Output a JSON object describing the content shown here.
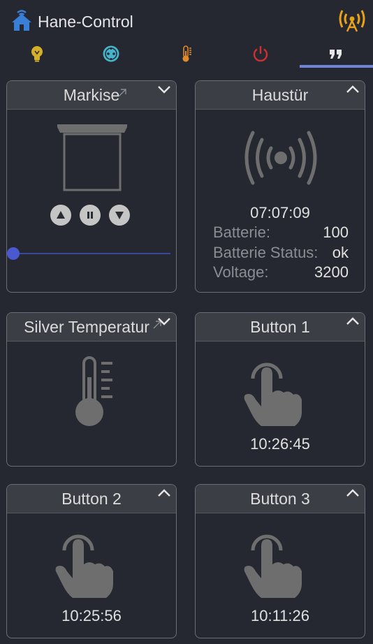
{
  "app": {
    "title": "Hane-Control"
  },
  "colors": {
    "background": "#252830",
    "card_header": "#3b3e45",
    "accent": "#6f84d8",
    "slider": "#4a59d0",
    "home_icon": "#3a7fd6",
    "signal_icon": "#e8a21a"
  },
  "tabs": [
    {
      "icon": "lightbulb-icon",
      "color": "#d4b02a"
    },
    {
      "icon": "socket-icon",
      "color": "#45b3c9"
    },
    {
      "icon": "thermometer-icon",
      "color": "#e08a2a"
    },
    {
      "icon": "power-icon",
      "color": "#d03030"
    },
    {
      "icon": "quote-icon",
      "color": "#e6e6e6",
      "active": true
    }
  ],
  "cards": {
    "markise": {
      "title": "Markise",
      "slider_value": 0
    },
    "haustuer": {
      "title": "Haustür",
      "time": "07:07:09",
      "props": [
        {
          "key": "Batterie:",
          "value": "100"
        },
        {
          "key": "Batterie Status:",
          "value": "ok"
        },
        {
          "key": "Voltage:",
          "value": "3200"
        }
      ]
    },
    "silver": {
      "title": "Silver Temperatur"
    },
    "button1": {
      "title": "Button 1",
      "time": "10:26:45"
    },
    "button2": {
      "title": "Button 2",
      "time": "10:25:56"
    },
    "button3": {
      "title": "Button 3",
      "time": "10:11:26"
    }
  }
}
